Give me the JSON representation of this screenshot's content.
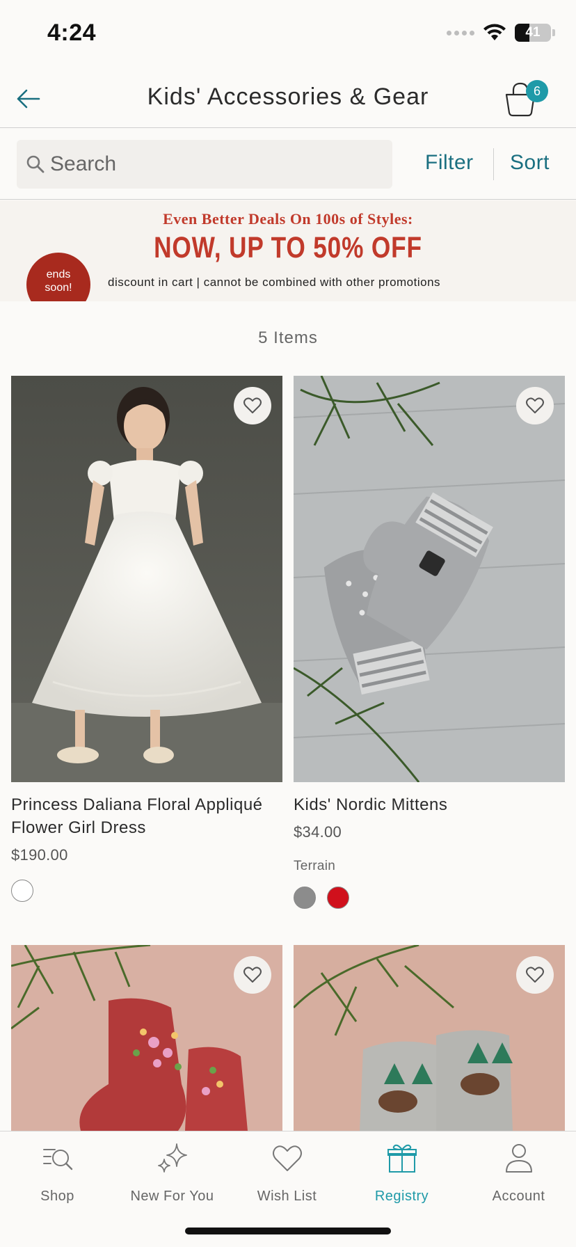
{
  "status_bar": {
    "time": "4:24",
    "battery": "41",
    "battery_level": 0.41
  },
  "header": {
    "title": "Kids' Accessories & Gear",
    "cart_count": "6"
  },
  "search": {
    "placeholder": "Search",
    "filter_label": "Filter",
    "sort_label": "Sort"
  },
  "promo": {
    "subtitle": "Even Better Deals On 100s of Styles:",
    "headline": "NOW, UP TO 50% OFF",
    "badge_line1": "ends",
    "badge_line2": "soon!",
    "fine_print": "discount in cart | cannot be combined with other promotions"
  },
  "results": {
    "count_label": "5 Items"
  },
  "products": [
    {
      "name": "Princess Daliana Floral Appliqué Flower Girl Dress",
      "price": "$190.00",
      "brand": "",
      "swatches": [
        "#ffffff"
      ]
    },
    {
      "name": "Kids' Nordic Mittens",
      "price": "$34.00",
      "brand": "Terrain",
      "swatches": [
        "#8c8c8c",
        "#d0101c"
      ]
    },
    {
      "name": "",
      "price": "",
      "brand": "",
      "swatches": []
    },
    {
      "name": "",
      "price": "",
      "brand": "",
      "swatches": []
    }
  ],
  "tabs": [
    {
      "label": "Shop",
      "icon": "shop-search-icon",
      "active": false
    },
    {
      "label": "New For You",
      "icon": "sparkle-icon",
      "active": false
    },
    {
      "label": "Wish List",
      "icon": "heart-icon",
      "active": false
    },
    {
      "label": "Registry",
      "icon": "gift-icon",
      "active": true
    },
    {
      "label": "Account",
      "icon": "person-icon",
      "active": false
    }
  ],
  "colors": {
    "accent": "#1f9aa8",
    "link": "#1a6f80",
    "promo_red": "#c13a2b"
  }
}
